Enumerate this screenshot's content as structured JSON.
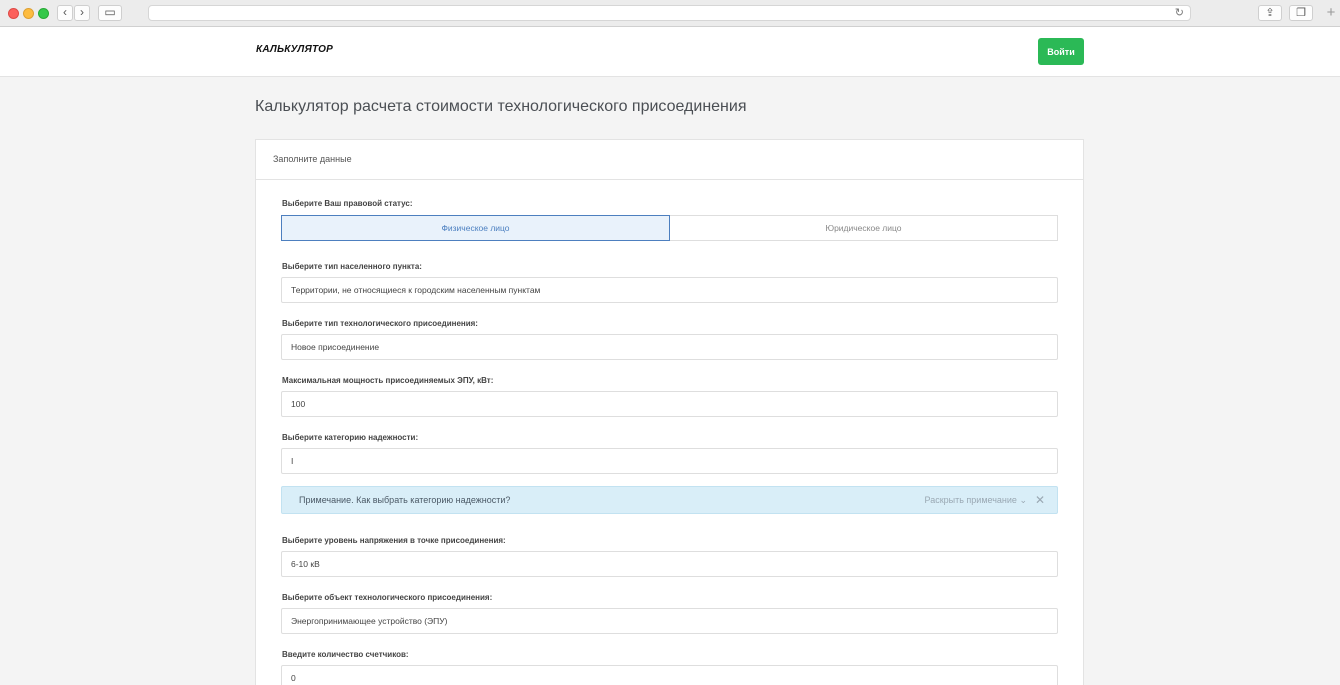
{
  "header": {
    "logo": "КАЛЬКУЛЯТОР",
    "login_label": "Войти"
  },
  "page_title": "Калькулятор расчета стоимости технологического присоединения",
  "card": {
    "heading": "Заполните данные",
    "legal_status": {
      "label": "Выберите Ваш правовой статус:",
      "options": [
        "Физическое лицо",
        "Юридическое лицо"
      ],
      "selected": "Физическое лицо"
    },
    "settlement_type": {
      "label": "Выберите тип населенного пункта:",
      "value": "Территории, не относящиеся к городским населенным пунктам"
    },
    "connection_type": {
      "label": "Выберите тип технологического присоединения:",
      "value": "Новое присоединение"
    },
    "max_power": {
      "label": "Максимальная мощность присоединяемых ЭПУ, кВт:",
      "value": "100"
    },
    "reliability": {
      "label": "Выберите категорию надежности:",
      "value": "I"
    },
    "note": {
      "text": "Примечание. Как выбрать категорию надежности?",
      "expand": "Раскрыть примечание",
      "close": "✕"
    },
    "voltage": {
      "label": "Выберите уровень напряжения в точке присоединения:",
      "value": "6-10 кВ"
    },
    "object": {
      "label": "Выберите объект технологического присоединения:",
      "value": "Энергопринимающее устройство (ЭПУ)"
    },
    "meters": {
      "label": "Введите количество счетчиков:",
      "value": "0"
    }
  },
  "colors": {
    "accent_green": "#2bb956",
    "active_blue": "#4b7fc0",
    "note_bg": "#d9eef8"
  }
}
